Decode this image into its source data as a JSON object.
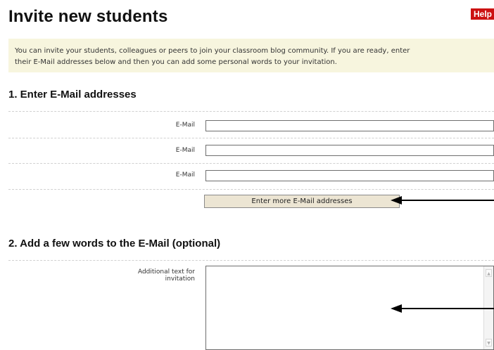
{
  "page": {
    "title": "Invite new students",
    "help_label": "Help",
    "intro_line1": "You can invite your students, colleagues or peers to join your classroom blog community. If you are ready, enter",
    "intro_line2": "their E-Mail addresses below and then you can add some personal words to your invitation."
  },
  "section1": {
    "heading": "1. Enter E-Mail addresses",
    "fields": [
      {
        "label": "E-Mail",
        "value": ""
      },
      {
        "label": "E-Mail",
        "value": ""
      },
      {
        "label": "E-Mail",
        "value": ""
      }
    ],
    "more_button_label": "Enter more E-Mail addresses"
  },
  "section2": {
    "heading": "2. Add a few words to the E-Mail (optional)",
    "textarea_label": "Additional text for invitation",
    "textarea_value": ""
  },
  "colors": {
    "help_badge": "#cc1111",
    "intro_background": "#f7f5de",
    "button_background": "#ece5d3"
  },
  "icons": {
    "scroll_up": "scroll-up-arrow-icon",
    "scroll_down": "scroll-down-arrow-icon",
    "annotation": "left-arrow-icon"
  }
}
